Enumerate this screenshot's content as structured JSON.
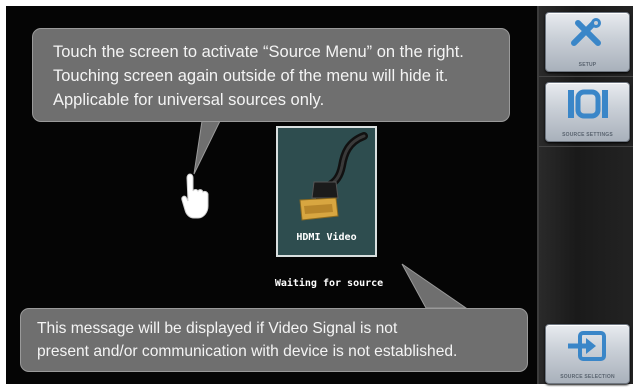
{
  "callouts": {
    "top_lines": [
      "Touch the screen to activate “Source Menu” on the right.",
      "Touching screen again outside of the menu will hide it.",
      "Applicable for universal sources only."
    ],
    "bottom_lines": [
      "This message will be displayed if Video Signal is not",
      "present and/or communication with device is not established."
    ]
  },
  "source_tile": {
    "label": "HDMI Video",
    "icon": "hdmi-cable-icon"
  },
  "status": {
    "message": "Waiting for source"
  },
  "source_menu": {
    "setup_label": "SETUP",
    "setup_icon": "wrench-screwdriver-icon",
    "source_settings_label": "SOURCE SETTINGS",
    "source_settings_icon": "io-icon",
    "source_selection_label": "SOURCE SELECTION",
    "source_selection_icon": "input-arrow-icon"
  },
  "colors": {
    "background": "#050505",
    "callout": "#6f6f6f",
    "tile": "#2e4d4f",
    "button_icon": "#3a86c8"
  }
}
